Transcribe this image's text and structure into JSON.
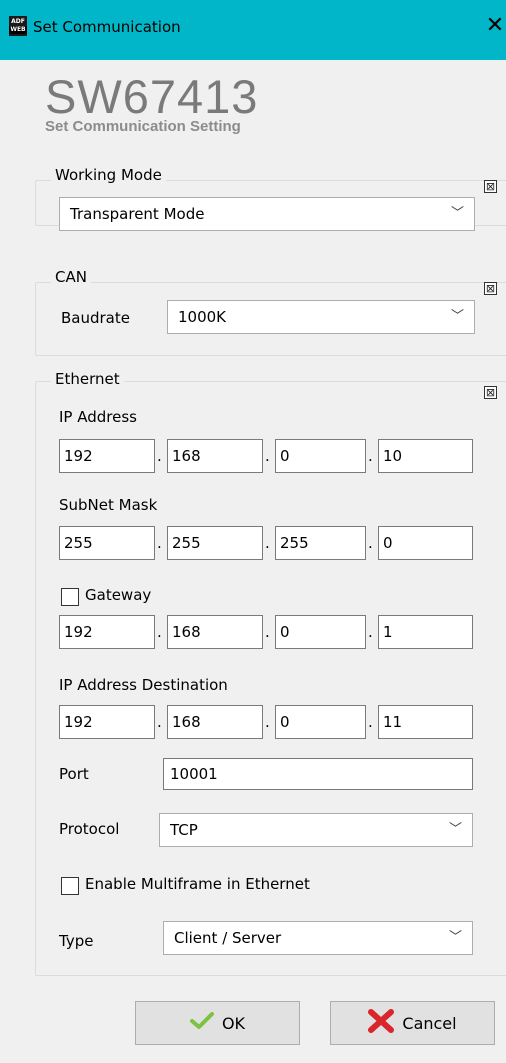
{
  "window": {
    "title": "Set Communication",
    "icon_text_top": "ADF",
    "icon_text_bottom": "WEB",
    "close_glyph": "✕"
  },
  "header": {
    "product": "SW67413",
    "subtitle": "Set Communication Setting"
  },
  "working_mode": {
    "title": "Working Mode",
    "selected": "Transparent Mode",
    "collapse_glyph": "⊠"
  },
  "can": {
    "title": "CAN",
    "baudrate_label": "Baudrate",
    "baudrate_value": "1000K",
    "collapse_glyph": "⊠"
  },
  "ethernet": {
    "title": "Ethernet",
    "collapse_glyph": "⊠",
    "ip_address_label": "IP Address",
    "ip_address": [
      "192",
      "168",
      "0",
      "10"
    ],
    "subnet_label": "SubNet Mask",
    "subnet": [
      "255",
      "255",
      "255",
      "0"
    ],
    "gateway_label": "Gateway",
    "gateway_checked": false,
    "gateway": [
      "192",
      "168",
      "0",
      "1"
    ],
    "ip_dest_label": "IP Address Destination",
    "ip_dest": [
      "192",
      "168",
      "0",
      "11"
    ],
    "port_label": "Port",
    "port_value": "10001",
    "protocol_label": "Protocol",
    "protocol_value": "TCP",
    "multiframe_label": "Enable Multiframe in Ethernet",
    "multiframe_checked": false,
    "type_label": "Type",
    "type_value": "Client / Server",
    "dot": "."
  },
  "buttons": {
    "ok_label": "OK",
    "cancel_label": "Cancel"
  },
  "icons": {
    "chevron": "﹀",
    "ok_check_color": "#7dc242",
    "cancel_x_color": "#d9262c"
  }
}
